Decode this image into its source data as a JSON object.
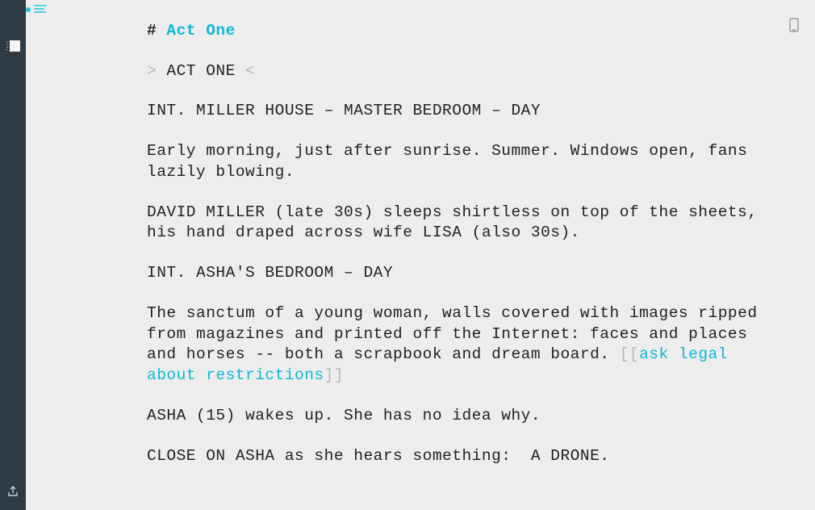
{
  "heading": {
    "hash": "#",
    "title": "Act One"
  },
  "marker": {
    "left": ">",
    "label": "ACT ONE",
    "right": "<"
  },
  "scene1_slug": "INT. MILLER HOUSE – MASTER BEDROOM – DAY",
  "scene1_desc": "Early morning, just after sunrise. Summer. Windows open, fans lazily blowing.",
  "scene1_action": "DAVID MILLER (late 30s) sleeps shirtless on top of the sheets, his hand draped across wife LISA (also 30s).",
  "scene2_slug": "INT. ASHA'S BEDROOM – DAY",
  "scene2_desc_a": "The sanctum of a young woman, walls covered with images ripped from magazines and printed off the Internet: faces and places and horses -- both a scrapbook and dream board. ",
  "note_open": "[[",
  "note_text": "ask legal about restrictions",
  "note_close": "]]",
  "scene2_action1": "ASHA (15) wakes up. She has no idea why.",
  "scene2_action2": "CLOSE ON ASHA as she hears something:  A DRONE."
}
